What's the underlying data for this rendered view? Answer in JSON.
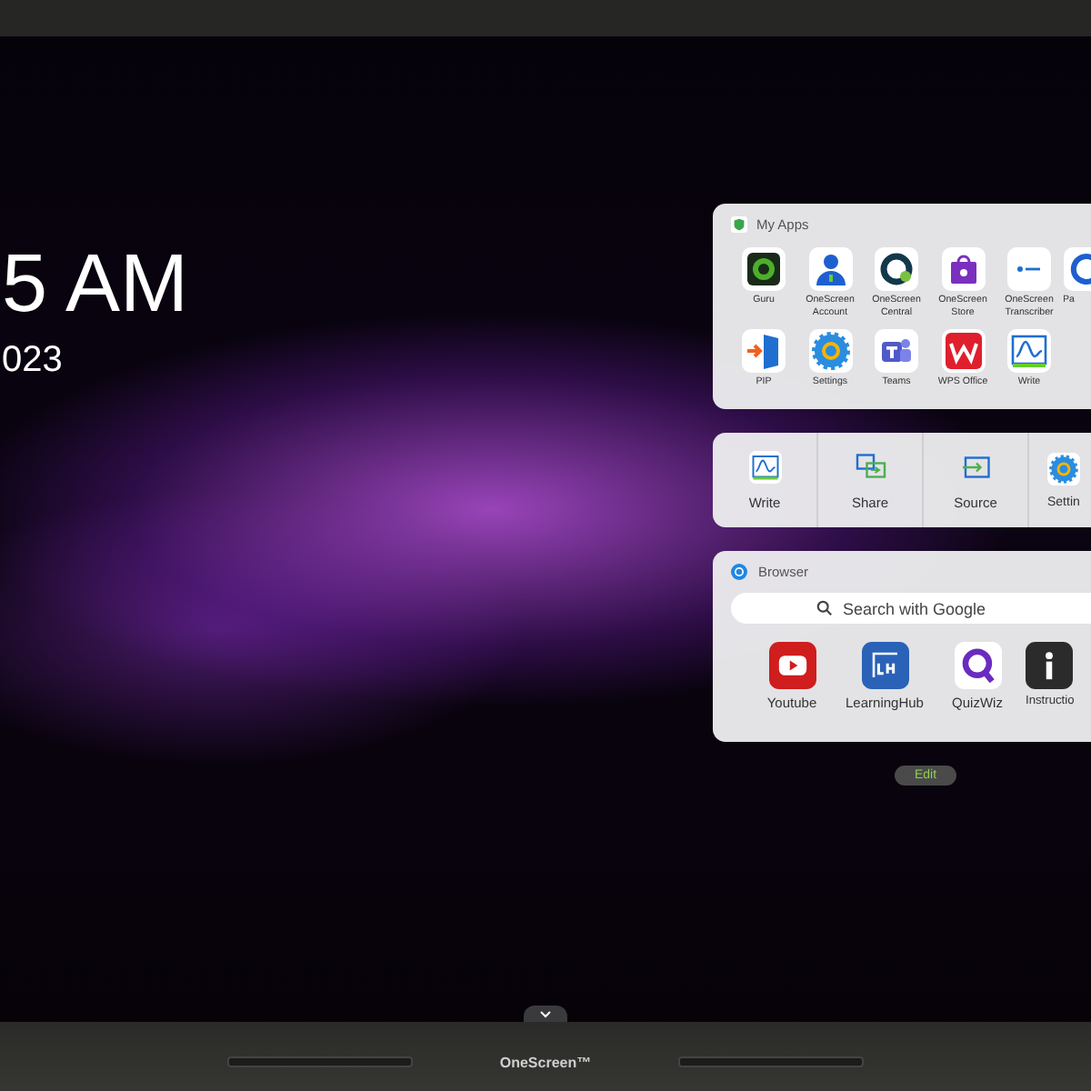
{
  "clock": {
    "time": "5 AM",
    "date": "023"
  },
  "my_apps": {
    "title": "My Apps",
    "apps": [
      {
        "label": "Guru",
        "kind": "guru"
      },
      {
        "label": "OneScreen Account",
        "kind": "account"
      },
      {
        "label": "OneScreen Central",
        "kind": "central"
      },
      {
        "label": "OneScreen Store",
        "kind": "store"
      },
      {
        "label": "OneScreen Transcriber",
        "kind": "transcriber"
      },
      {
        "label": "Pa",
        "kind": "partial"
      },
      {
        "label": "PIP",
        "kind": "pip"
      },
      {
        "label": "Settings",
        "kind": "settings"
      },
      {
        "label": "Teams",
        "kind": "teams"
      },
      {
        "label": "WPS Office",
        "kind": "wps"
      },
      {
        "label": "Write",
        "kind": "write"
      }
    ]
  },
  "quick_actions": [
    {
      "label": "Write",
      "kind": "write"
    },
    {
      "label": "Share",
      "kind": "share"
    },
    {
      "label": "Source",
      "kind": "source"
    },
    {
      "label": "Settin",
      "kind": "settings"
    }
  ],
  "browser": {
    "title": "Browser",
    "search": {
      "placeholder": "Search with Google"
    },
    "shortcuts": [
      {
        "label": "Youtube",
        "kind": "youtube"
      },
      {
        "label": "LearningHub",
        "kind": "learninghub"
      },
      {
        "label": "QuizWiz",
        "kind": "quizwiz"
      },
      {
        "label": "Instructio",
        "kind": "info"
      }
    ]
  },
  "edit_button": "Edit",
  "bezel": {
    "logo": "OneScreen™"
  }
}
